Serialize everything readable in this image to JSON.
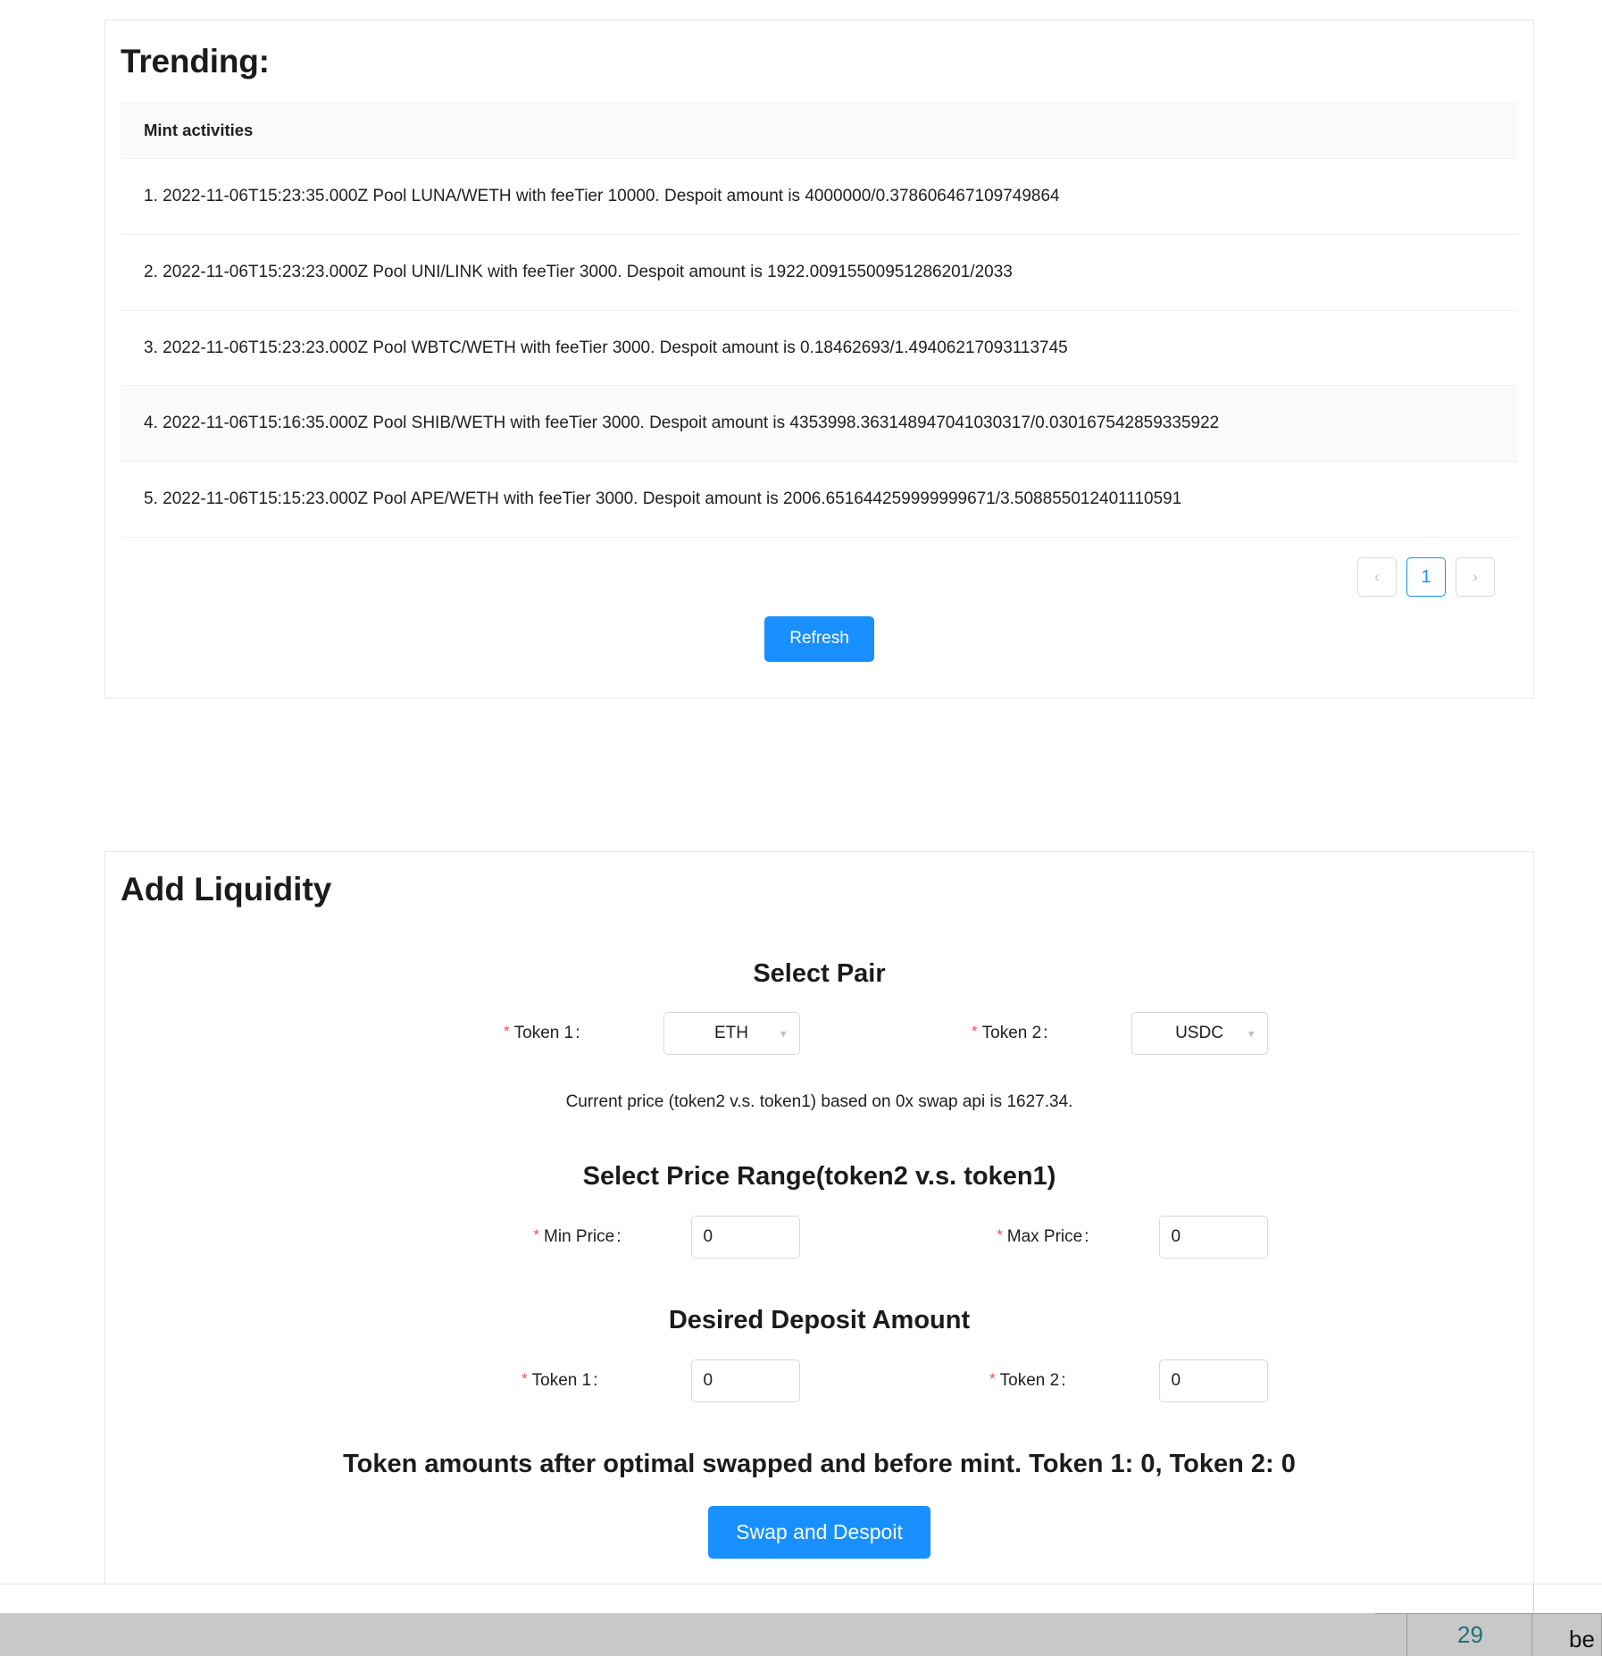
{
  "trending": {
    "title": "Trending:",
    "list_header": "Mint activities",
    "items": [
      "1. 2022-11-06T15:23:35.000Z Pool LUNA/WETH with feeTier 10000. Despoit amount is 4000000/0.378606467109749864",
      "2. 2022-11-06T15:23:23.000Z Pool UNI/LINK with feeTier 3000. Despoit amount is 1922.00915500951286201/2033",
      "3. 2022-11-06T15:23:23.000Z Pool WBTC/WETH with feeTier 3000. Despoit amount is 0.18462693/1.49406217093113745",
      "4. 2022-11-06T15:16:35.000Z Pool SHIB/WETH with feeTier 3000. Despoit amount is 4353998.363148947041030317/0.030167542859335922",
      "5. 2022-11-06T15:15:23.000Z Pool APE/WETH with feeTier 3000. Despoit amount is 2006.651644259999999671/3.508855012401110591"
    ],
    "pagination": {
      "prev_icon": "chevron-left-icon",
      "next_icon": "chevron-right-icon",
      "current_page": "1"
    },
    "refresh_label": "Refresh"
  },
  "liquidity": {
    "title": "Add Liquidity",
    "select_pair_heading": "Select Pair",
    "token1_label": "Token 1",
    "token2_label": "Token 2",
    "token1_value": "ETH",
    "token2_value": "USDC",
    "required_marker": "*",
    "label_colon": ":",
    "caret_icon": "chevron-down-icon",
    "current_price_text": "Current price (token2 v.s. token1) based on 0x swap api is 1627.34.",
    "price_range_heading": "Select Price Range(token2 v.s. token1)",
    "min_price_label": "Min Price",
    "max_price_label": "Max Price",
    "min_price_value": "0",
    "max_price_value": "0",
    "deposit_heading": "Desired Deposit Amount",
    "deposit_token1_label": "Token 1",
    "deposit_token2_label": "Token 2",
    "deposit_token1_value": "0",
    "deposit_token2_value": "0",
    "optimal_note": "Token amounts after optimal swapped and before mint. Token 1: 0, Token 2: 0",
    "swap_button_label": "Swap and Despoit"
  },
  "background": {
    "spreadsheet_number": "29",
    "spreadsheet_text": "be"
  },
  "colors": {
    "accent": "#1890ff",
    "required": "#ff4d4f",
    "border": "#e8e8e8",
    "row_alt": "#fafafa"
  }
}
